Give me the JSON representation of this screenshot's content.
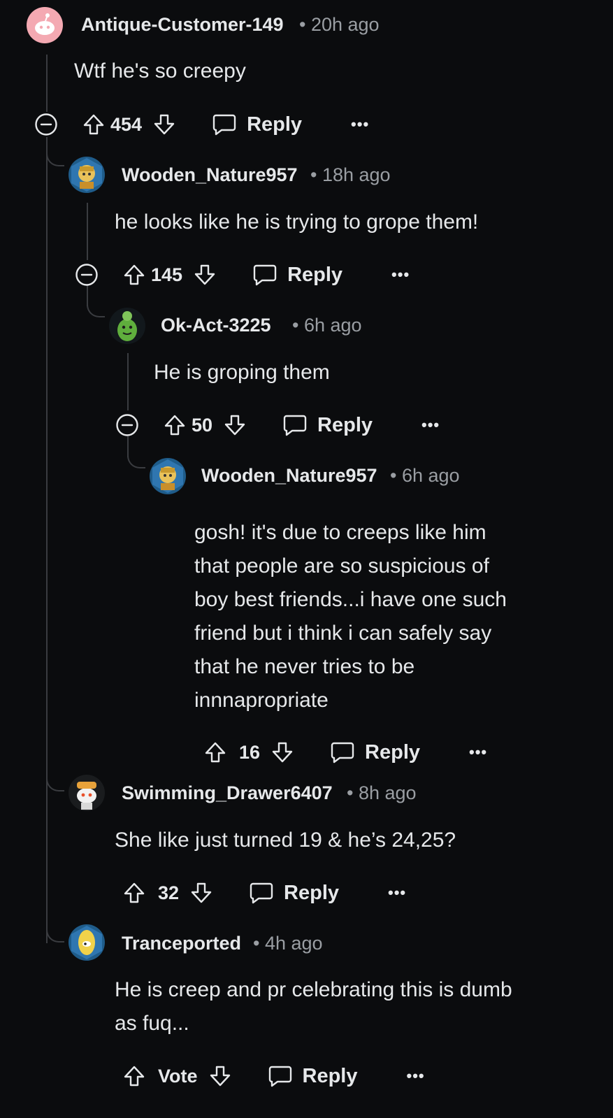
{
  "comments": [
    {
      "user": "Antique-Customer-149",
      "time": "20h ago",
      "text": "Wtf he's so creepy",
      "votes": "454",
      "reply": "Reply",
      "more": "•••"
    },
    {
      "user": "Wooden_Nature957",
      "time": "18h ago",
      "text": "he looks like he is trying to grope them!",
      "votes": "145",
      "reply": "Reply",
      "more": "•••"
    },
    {
      "user": "Ok-Act-3225",
      "time": "6h ago",
      "text": "He is groping them",
      "votes": "50",
      "reply": "Reply",
      "more": "•••"
    },
    {
      "user": "Wooden_Nature957",
      "time": "6h ago",
      "text_lines": [
        "gosh! it's due to creeps like him",
        "that people are so suspicious of",
        "boy best friends...i have one such",
        "friend but i think i can safely say",
        "that he never tries to be",
        "innnapropriate"
      ],
      "votes": "16",
      "reply": "Reply",
      "more": "•••"
    },
    {
      "user": "Swimming_Drawer6407",
      "time": "8h ago",
      "text": "She like just turned 19 & he’s 24,25?",
      "votes": "32",
      "reply": "Reply",
      "more": "•••"
    },
    {
      "user": "Tranceported",
      "time": "4h ago",
      "text_lines": [
        "He is creep and pr celebrating this is dumb",
        "as fuq..."
      ],
      "votes": "Vote",
      "reply": "Reply",
      "more": "•••"
    }
  ],
  "separator": "•",
  "colors": {
    "background": "#0b0c0e",
    "thread": "#3a3c40",
    "text": "#e6e8ea",
    "muted": "#9a9ea3"
  },
  "icons": [
    "collapse-icon",
    "upvote-icon",
    "downvote-icon",
    "reply-bubble-icon",
    "more-icon",
    "avatar-icon"
  ]
}
